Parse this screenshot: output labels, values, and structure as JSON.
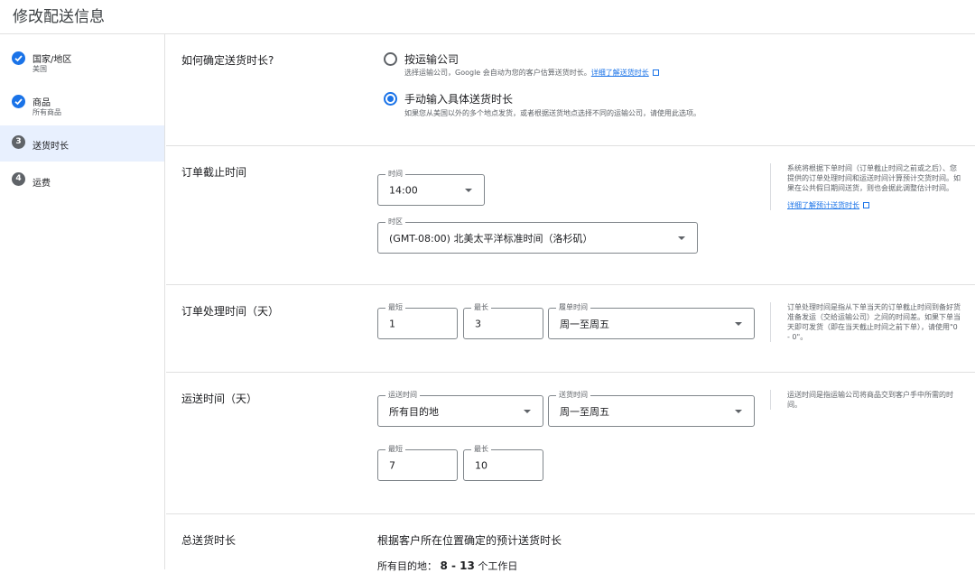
{
  "page": {
    "title": "修改配送信息"
  },
  "steps": [
    {
      "label": "国家/地区",
      "sub": "美国",
      "state": "done"
    },
    {
      "label": "商品",
      "sub": "所有商品",
      "state": "done"
    },
    {
      "label": "送货时长",
      "num": "3",
      "state": "active"
    },
    {
      "label": "运费",
      "num": "4",
      "state": "pending"
    }
  ],
  "method": {
    "title": "如何确定送货时长?",
    "options": [
      {
        "label": "按运输公司",
        "desc": "选择运输公司，Google 会自动为您的客户估算送货时长。",
        "link": "详细了解送货时长",
        "selected": false
      },
      {
        "label": "手动输入具体送货时长",
        "desc": "如果您从美国以外的多个地点发货，或者根据送货地点选择不同的运输公司，请使用此选项。",
        "selected": true
      }
    ]
  },
  "cutoff": {
    "title": "订单截止时间",
    "time_label": "时间",
    "time_value": "14:00",
    "tz_label": "时区",
    "tz_value": "(GMT-08:00) 北美太平洋标准时间（洛杉矶）",
    "help": "系统将根据下单时间（订单截止时间之前或之后）、您提供的订单处理时间和运送时间计算预计交货时间。如果在公共假日期间送货，则也会据此调整估计时间。",
    "help_link": "详细了解预计送货时长"
  },
  "handling": {
    "title": "订单处理时间（天）",
    "min_label": "最短",
    "min_value": "1",
    "max_label": "最长",
    "max_value": "3",
    "days_label": "履单时间",
    "days_value": "周一至周五",
    "help": "订单处理时间是指从下单当天的订单截止时间到备好货准备发运（交给运输公司）之间的时间差。如果下单当天即可发货（即在当天截止时间之前下单），请使用\"0 - 0\"。"
  },
  "transit": {
    "title": "运送时间（天）",
    "dest_label": "运送时间",
    "dest_value": "所有目的地",
    "days_label": "送货时间",
    "days_value": "周一至周五",
    "min_label": "最短",
    "min_value": "7",
    "max_label": "最长",
    "max_value": "10",
    "help": "运送时间是指运输公司将商品交到客户手中所需的时间。"
  },
  "total": {
    "title": "总送货时长",
    "desc": "根据客户所在位置确定的预计送货时长",
    "dest": "所有目的地：",
    "range": "8 - 13",
    "unit": "个工作日"
  }
}
